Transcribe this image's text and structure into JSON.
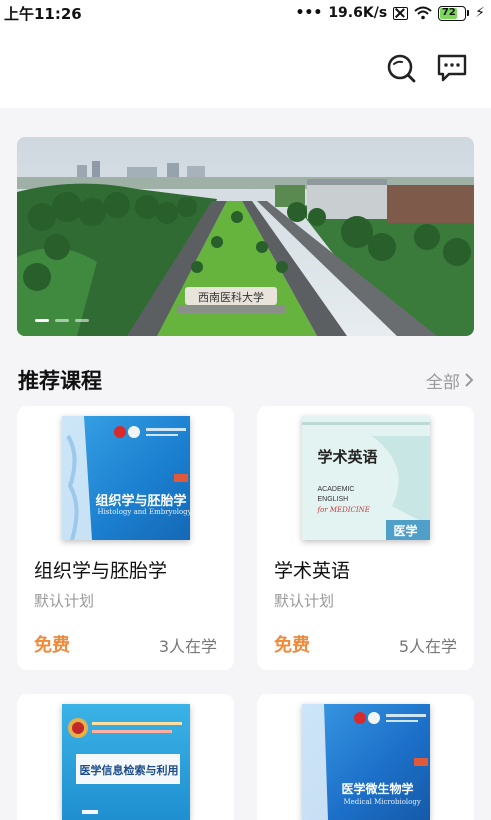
{
  "status_bar": {
    "time": "上午11:26",
    "network_speed": "19.6K/s",
    "battery_level": "72"
  },
  "icons": {
    "search": "search-icon",
    "message": "message-icon",
    "chevron": "chevron-right-icon"
  },
  "banner": {
    "sign_text": "西南医科大学",
    "slide_count": 3,
    "active_slide": 0
  },
  "recommended": {
    "title": "推荐课程",
    "see_all": "全部"
  },
  "courses": [
    {
      "title": "组织学与胚胎学",
      "plan": "默认计划",
      "price": "免费",
      "learners": "3人在学",
      "cover_title": "组织学与胚胎学",
      "cover_subtitle": "Histology and Embryology",
      "cover_color": "#1f8fd6"
    },
    {
      "title": "学术英语",
      "plan": "默认计划",
      "price": "免费",
      "learners": "5人在学",
      "cover_title": "学术英语",
      "cover_lines": [
        "ACADEMIC",
        "ENGLISH",
        "for MEDICINE"
      ],
      "cover_tag": "医学",
      "cover_color": "#d9f0ee"
    },
    {
      "cover_title": "医学信息检索与利用",
      "cover_color": "#2fa9df"
    },
    {
      "cover_title": "医学微生物学",
      "cover_subtitle": "Medical Microbiology",
      "cover_color": "#1f78cf"
    }
  ],
  "colors": {
    "price": "#f08a3a",
    "background": "#f5f5f7"
  }
}
